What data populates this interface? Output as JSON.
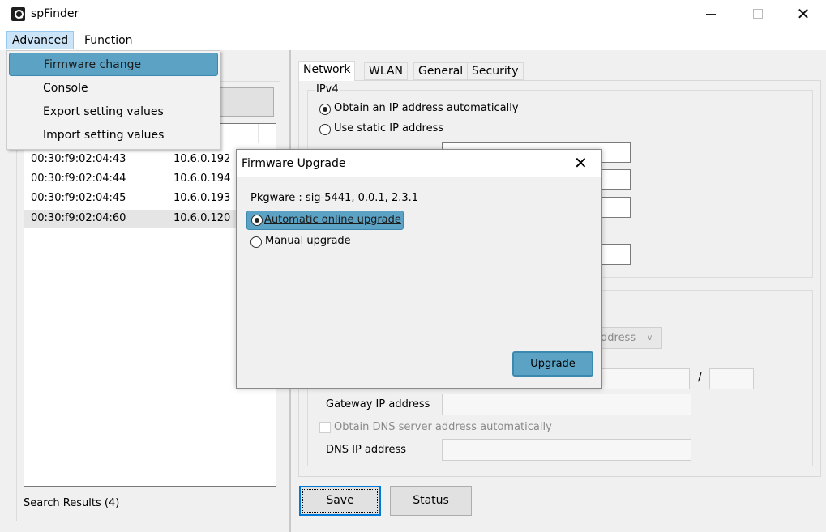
{
  "window": {
    "title": "spFinder",
    "controls": {
      "minimize": "",
      "maximize": "",
      "close": "✕"
    }
  },
  "menubar": {
    "items": [
      "Advanced",
      "Function"
    ]
  },
  "advanced_menu": {
    "items": [
      "Firmware change",
      "Console",
      "Export setting values",
      "Import setting values"
    ],
    "highlighted": "Firmware change"
  },
  "devices": [
    {
      "mac": "00:30:f9:02:04:43",
      "ip": "10.6.0.192"
    },
    {
      "mac": "00:30:f9:02:04:44",
      "ip": "10.6.0.194"
    },
    {
      "mac": "00:30:f9:02:04:45",
      "ip": "10.6.0.193"
    },
    {
      "mac": "00:30:f9:02:04:60",
      "ip": "10.6.0.120"
    }
  ],
  "search_results": "Search Results (4)",
  "tabs": [
    "Network",
    "WLAN",
    "General",
    "Security"
  ],
  "network": {
    "ipv4_title": "IPv4",
    "auto_ip_label": "Obtain an IP address automatically",
    "static_ip_label": "Use static IP address",
    "addr_select_text": "ddress",
    "slash": "/",
    "gateway_label": "Gateway IP address",
    "dns_auto_label": "Obtain DNS server address automatically",
    "dns_label": "DNS IP address"
  },
  "buttons": {
    "save": "Save",
    "status": "Status"
  },
  "dialog": {
    "title": "Firmware Upgrade",
    "close": "✕",
    "pkgware": "Pkgware : sig-5441, 0.0.1, 2.3.1",
    "auto_label": "Automatic online upgrade",
    "manual_label": "Manual upgrade",
    "upgrade_button": "Upgrade"
  },
  "colors": {
    "highlight": "#5ba2c4",
    "focus_border": "#0078d7"
  }
}
